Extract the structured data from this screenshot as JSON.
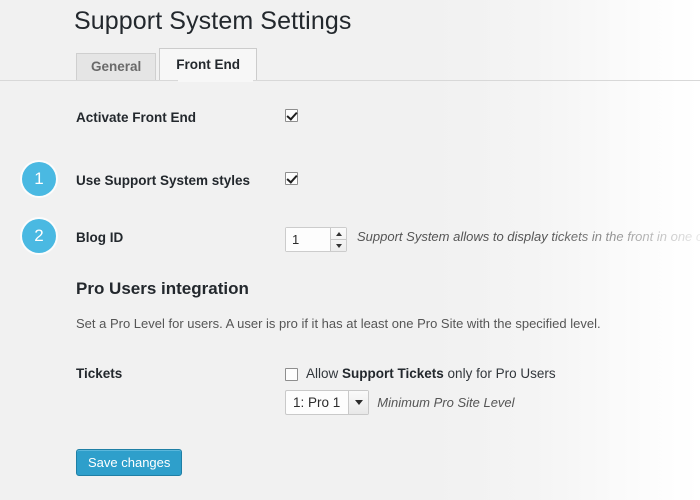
{
  "page": {
    "title": "Support System Settings"
  },
  "tabs": [
    {
      "label": "General",
      "active": false
    },
    {
      "label": "Front End",
      "active": true
    }
  ],
  "rows": {
    "activate_front_end": {
      "label": "Activate Front End",
      "checked": true
    },
    "use_styles": {
      "badge": "1",
      "label": "Use Support System styles",
      "checked": true
    },
    "blog_id": {
      "badge": "2",
      "label": "Blog ID",
      "value": "1",
      "description": "Support System allows to display tickets in the front in one of yo"
    }
  },
  "pro_users": {
    "heading": "Pro Users integration",
    "description": "Set a Pro Level for users. A user is pro if it has at least one Pro Site with the specified level.",
    "tickets": {
      "label": "Tickets",
      "checked": false,
      "text_before": "Allow ",
      "text_bold": "Support Tickets",
      "text_after": " only for Pro Users",
      "select_value": "1: Pro 1",
      "select_description": "Minimum Pro Site Level"
    }
  },
  "footer": {
    "save_label": "Save changes"
  },
  "colors": {
    "badge": "#4ab9e2",
    "button": "#2e9fcb",
    "background": "#f1f1f1",
    "title_text": "#23282d"
  }
}
